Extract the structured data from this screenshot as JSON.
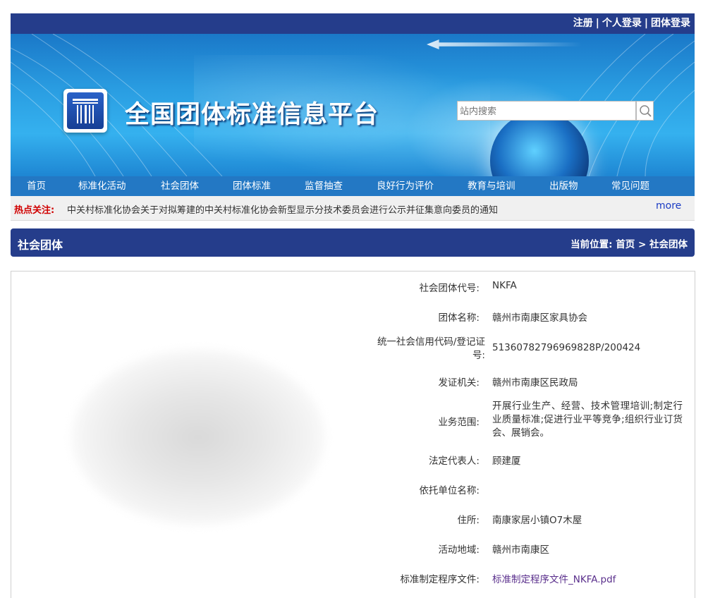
{
  "top_links": {
    "register": "注册",
    "personal_login": "个人登录",
    "group_login": "团体登录",
    "separator": "|"
  },
  "site": {
    "title": "全国团体标准信息平台"
  },
  "search": {
    "placeholder": "站内搜索"
  },
  "nav": [
    "首页",
    "标准化活动",
    "社会团体",
    "团体标准",
    "监督抽查",
    "良好行为评价",
    "教育与培训",
    "出版物",
    "常见问题"
  ],
  "hot": {
    "label": "热点关注:",
    "text": "中关村标准化协会关于对拟筹建的中关村标准化协会新型显示分技术委员会进行公示并征集意向委员的通知",
    "more": "more"
  },
  "section": {
    "title": "社会团体",
    "crumb_label": "当前位置:",
    "crumb_home": "首页",
    "crumb_sep": ">",
    "crumb_current": "社会团体"
  },
  "details": {
    "code_label": "社会团体代号:",
    "code": "NKFA",
    "name_label": "团体名称:",
    "name": "赣州市南康区家具协会",
    "credit_label_1": "统一社会信用代码/登记证",
    "credit_label_2": "号:",
    "credit": "51360782796969828P/200424",
    "issuer_label": "发证机关:",
    "issuer": "赣州市南康区民政局",
    "scope_label": "业务范围:",
    "scope": "开展行业生产、经营、技术管理培训;制定行业质量标准;促进行业平等竞争;组织行业订货会、展销会。",
    "rep_label": "法定代表人:",
    "rep": "顾建厦",
    "sponsor_label": "依托单位名称:",
    "sponsor": "",
    "address_label": "住所:",
    "address": "南康家居小镇O7木屋",
    "region_label": "活动地域:",
    "region": "赣州市南康区",
    "procedure_label": "标准制定程序文件:",
    "procedure": "标准制定程序文件_NKFA.pdf"
  }
}
